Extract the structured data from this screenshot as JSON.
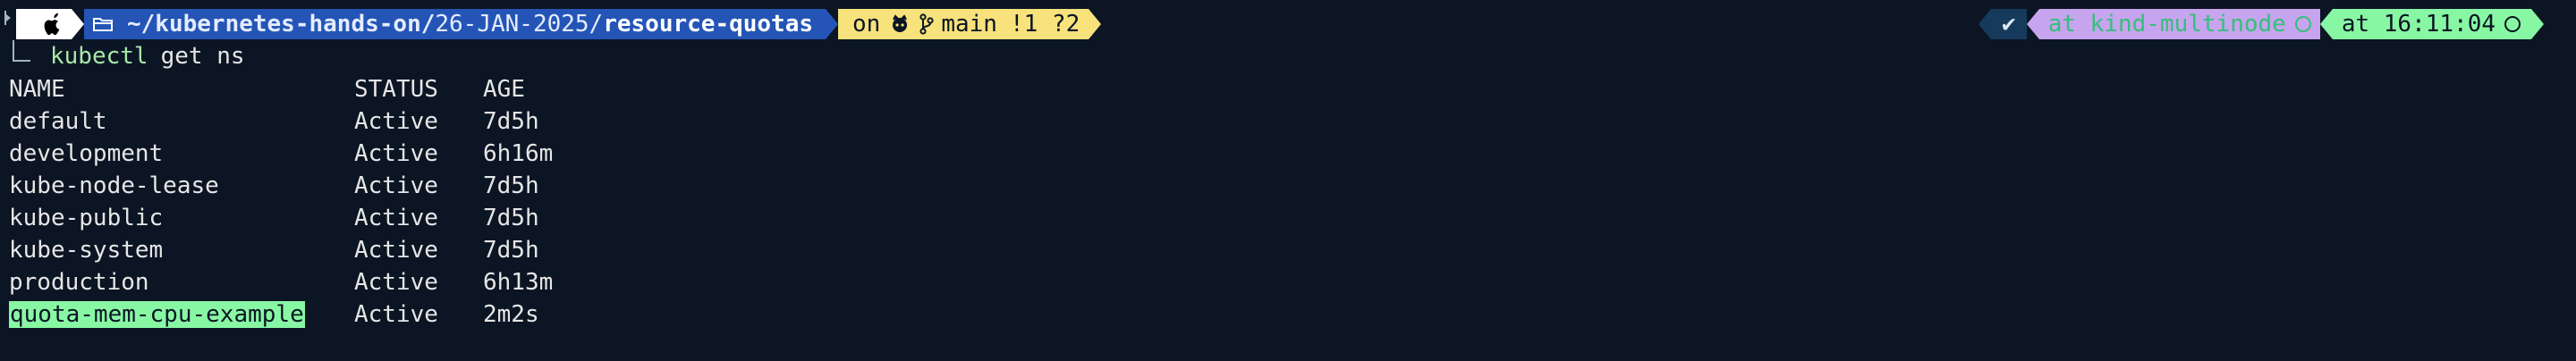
{
  "prompt": {
    "path_dir": "~/kubernetes-hands-on/",
    "path_sub": "26-JAN-2025/",
    "path_leaf": "resource-quotas",
    "on_label": "on",
    "git_branch_icon": "git-branch-icon",
    "branch": "main",
    "git_status": "!1 ?2",
    "check": "✔",
    "context": "at kind-multinode",
    "time": "at 16:11:04"
  },
  "command": {
    "name": "kubectl",
    "args": "get ns"
  },
  "table": {
    "headers": [
      "NAME",
      "STATUS",
      "AGE"
    ],
    "rows": [
      {
        "name": "default",
        "status": "Active",
        "age": "7d5h"
      },
      {
        "name": "development",
        "status": "Active",
        "age": "6h16m"
      },
      {
        "name": "kube-node-lease",
        "status": "Active",
        "age": "7d5h"
      },
      {
        "name": "kube-public",
        "status": "Active",
        "age": "7d5h"
      },
      {
        "name": "kube-system",
        "status": "Active",
        "age": "7d5h"
      },
      {
        "name": "production",
        "status": "Active",
        "age": "6h13m"
      },
      {
        "name": "quota-mem-cpu-example",
        "status": "Active",
        "age": "2m2s"
      }
    ]
  },
  "colors": {
    "background": "#0b1524",
    "path_bg": "#2455b6",
    "git_bg": "#f7e27b",
    "context_bg": "#c7a4ee",
    "time_bg": "#88f7a4",
    "highlight": "#88f7a4"
  }
}
